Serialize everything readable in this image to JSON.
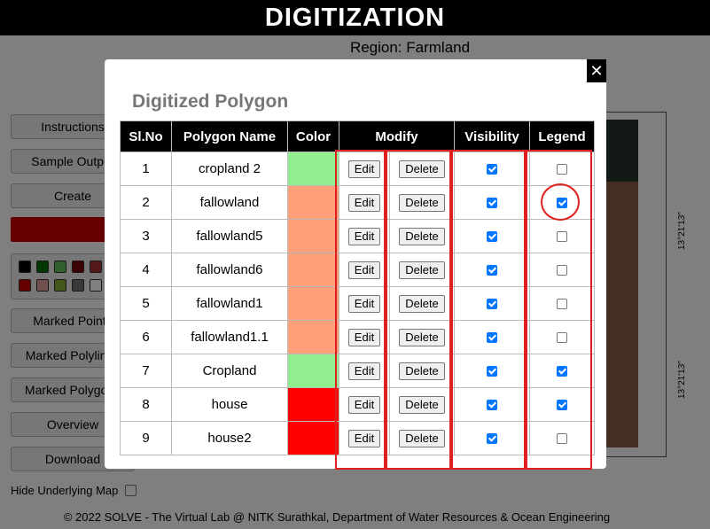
{
  "app": {
    "title": "DIGITIZATION",
    "region": "Region: Farmland"
  },
  "sidebar": {
    "buttons": [
      {
        "label": "Instructions"
      },
      {
        "label": "Sample Output"
      },
      {
        "label": "Create"
      },
      {
        "label": "Marked Points"
      },
      {
        "label": "Marked Polylines"
      },
      {
        "label": "Marked Polygons"
      },
      {
        "label": "Overview"
      },
      {
        "label": "Download"
      }
    ],
    "palette_colors": [
      "#000000",
      "#007000",
      "#60c060",
      "#7a0000",
      "#a83232",
      "#cc0000",
      "#e0a0a0",
      "#88aa33",
      "#707070",
      "#ffffff"
    ],
    "hide_map_label": "Hide Underlying Map"
  },
  "map": {
    "coord_top": "13°21'13\"",
    "coord_bottom": "13°21'13\""
  },
  "footer": "© 2022 SOLVE - The Virtual Lab @ NITK Surathkal, Department of Water Resources & Ocean Engineering",
  "modal": {
    "title": "Digitized Polygon",
    "close_symbol": "✕",
    "columns": [
      "Sl.No",
      "Polygon Name",
      "Color",
      "Modify",
      "Visibility",
      "Legend"
    ],
    "edit_label": "Edit",
    "delete_label": "Delete",
    "rows": [
      {
        "no": "1",
        "name": "cropland 2",
        "color": "#90ee90",
        "visible": true,
        "legend": false
      },
      {
        "no": "2",
        "name": "fallowland",
        "color": "#ffa07a",
        "visible": true,
        "legend": true
      },
      {
        "no": "3",
        "name": "fallowland5",
        "color": "#ffa07a",
        "visible": true,
        "legend": false
      },
      {
        "no": "4",
        "name": "fallowland6",
        "color": "#ffa07a",
        "visible": true,
        "legend": false
      },
      {
        "no": "5",
        "name": "fallowland1",
        "color": "#ffa07a",
        "visible": true,
        "legend": false
      },
      {
        "no": "6",
        "name": "fallowland1.1",
        "color": "#ffa07a",
        "visible": true,
        "legend": false
      },
      {
        "no": "7",
        "name": "Cropland",
        "color": "#90ee90",
        "visible": true,
        "legend": true
      },
      {
        "no": "8",
        "name": "house",
        "color": "#ff0000",
        "visible": true,
        "legend": true
      },
      {
        "no": "9",
        "name": "house2",
        "color": "#ff0000",
        "visible": true,
        "legend": false
      }
    ]
  },
  "annotations": {
    "color": "#e02020"
  }
}
